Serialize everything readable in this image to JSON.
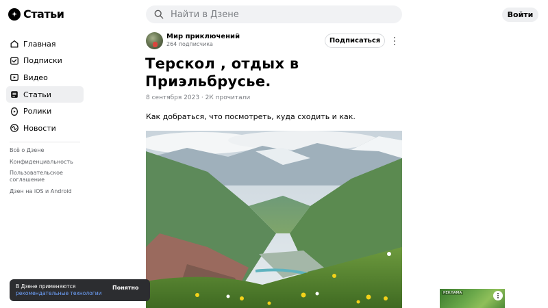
{
  "logo": {
    "text": "Статьи"
  },
  "search": {
    "placeholder": "Найти в Дзене"
  },
  "header": {
    "login_label": "Войти"
  },
  "nav": {
    "items": [
      {
        "label": "Главная",
        "icon": "home-icon"
      },
      {
        "label": "Подписки",
        "icon": "subscriptions-icon"
      },
      {
        "label": "Видео",
        "icon": "video-icon"
      },
      {
        "label": "Статьи",
        "icon": "articles-icon",
        "active": true
      },
      {
        "label": "Ролики",
        "icon": "shorts-icon"
      },
      {
        "label": "Новости",
        "icon": "news-icon"
      }
    ]
  },
  "footer_links": [
    "Всё о Дзене",
    "Конфиденциальность",
    "Пользовательское соглашение",
    "Дзен на iOS и Android"
  ],
  "channel": {
    "name": "Мир приключений",
    "subscribers": "264 подписчика",
    "subscribe_label": "Подписаться"
  },
  "article": {
    "title": "Терскол , отдых в Приэльбрусье.",
    "meta": "8 сентября 2023 · 2К прочитали",
    "lead": "Как добраться, что посмотреть, куда сходить и как."
  },
  "cookie": {
    "text": "В Дзене применяются",
    "link": "рекомендательные технологии",
    "button": "Понятно"
  },
  "ad": {
    "label": "РЕКЛАМА"
  },
  "colors": {
    "accent_link": "#6fa3ff",
    "active_nav_bg": "#eeeff1",
    "banner_bg": "#2c2d30"
  }
}
